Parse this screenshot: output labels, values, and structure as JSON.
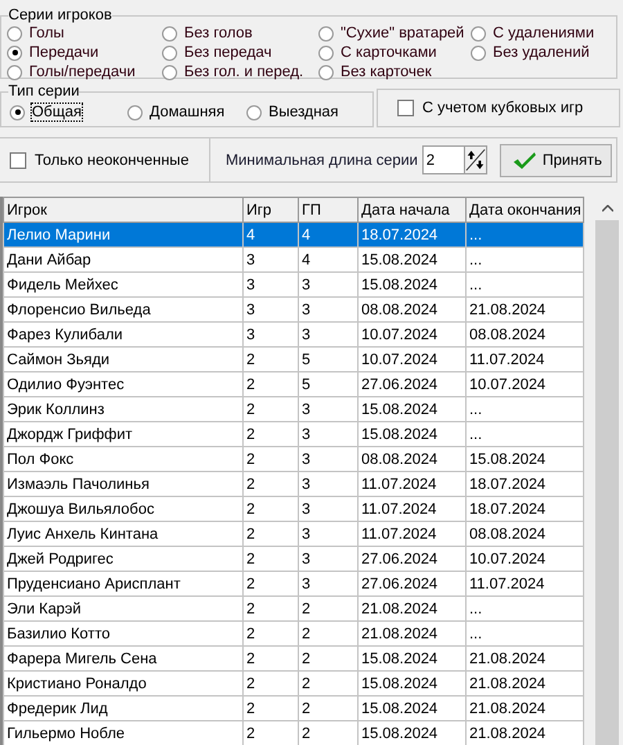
{
  "series_group": {
    "legend": "Серии игроков",
    "options": [
      {
        "label": "Голы",
        "selected": false
      },
      {
        "label": "Без голов",
        "selected": false
      },
      {
        "label": "\"Сухие\" вратарей",
        "selected": false
      },
      {
        "label": "С удалениями",
        "selected": false
      },
      {
        "label": "Передачи",
        "selected": true
      },
      {
        "label": "Без передач",
        "selected": false
      },
      {
        "label": "С карточками",
        "selected": false
      },
      {
        "label": "Без удалений",
        "selected": false
      },
      {
        "label": "Голы/передачи",
        "selected": false
      },
      {
        "label": "Без гол. и перед.",
        "selected": false
      },
      {
        "label": "Без карточек",
        "selected": false
      }
    ]
  },
  "type_group": {
    "legend": "Тип серии",
    "options": [
      {
        "label": "Общая",
        "selected": true
      },
      {
        "label": "Домашняя",
        "selected": false
      },
      {
        "label": "Выездная",
        "selected": false
      }
    ]
  },
  "cup_games": {
    "label": "С учетом кубковых игр",
    "checked": false
  },
  "only_unfinished": {
    "label": "Только неоконченные",
    "checked": false
  },
  "min_length": {
    "label": "Минимальная длина серии",
    "value": "2"
  },
  "apply_button": "Принять",
  "table": {
    "columns": [
      "Игрок",
      "Игр",
      "ГП",
      "Дата начала",
      "Дата окончания"
    ],
    "rows": [
      {
        "selected": true,
        "cells": [
          "Лелио Марини",
          "4",
          "4",
          "18.07.2024",
          "..."
        ]
      },
      {
        "selected": false,
        "cells": [
          "Дани Айбар",
          "3",
          "4",
          "15.08.2024",
          "..."
        ]
      },
      {
        "selected": false,
        "cells": [
          "Фидель Мейхес",
          "3",
          "3",
          "15.08.2024",
          "..."
        ]
      },
      {
        "selected": false,
        "cells": [
          "Флоренсио Вильеда",
          "3",
          "3",
          "08.08.2024",
          "21.08.2024"
        ]
      },
      {
        "selected": false,
        "cells": [
          "Фарез Кулибали",
          "3",
          "3",
          "10.07.2024",
          "08.08.2024"
        ]
      },
      {
        "selected": false,
        "cells": [
          "Саймон Зьяди",
          "2",
          "5",
          "10.07.2024",
          "11.07.2024"
        ]
      },
      {
        "selected": false,
        "cells": [
          "Одилио Фуэнтес",
          "2",
          "5",
          "27.06.2024",
          "10.07.2024"
        ]
      },
      {
        "selected": false,
        "cells": [
          "Эрик Коллинз",
          "2",
          "3",
          "15.08.2024",
          "..."
        ]
      },
      {
        "selected": false,
        "cells": [
          "Джордж Гриффит",
          "2",
          "3",
          "15.08.2024",
          "..."
        ]
      },
      {
        "selected": false,
        "cells": [
          "Пол Фокс",
          "2",
          "3",
          "08.08.2024",
          "15.08.2024"
        ]
      },
      {
        "selected": false,
        "cells": [
          "Измаэль Пачолинья",
          "2",
          "3",
          "11.07.2024",
          "18.07.2024"
        ]
      },
      {
        "selected": false,
        "cells": [
          "Джошуа Вильялобос",
          "2",
          "3",
          "11.07.2024",
          "18.07.2024"
        ]
      },
      {
        "selected": false,
        "cells": [
          "Луис Анхель Кинтана",
          "2",
          "3",
          "11.07.2024",
          "08.08.2024"
        ]
      },
      {
        "selected": false,
        "cells": [
          "Джей Родригес",
          "2",
          "3",
          "27.06.2024",
          "10.07.2024"
        ]
      },
      {
        "selected": false,
        "cells": [
          "Пруденсиано Арисплант",
          "2",
          "3",
          "27.06.2024",
          "11.07.2024"
        ]
      },
      {
        "selected": false,
        "cells": [
          "Эли Карэй",
          "2",
          "2",
          "21.08.2024",
          "..."
        ]
      },
      {
        "selected": false,
        "cells": [
          "Базилио Котто",
          "2",
          "2",
          "21.08.2024",
          "..."
        ]
      },
      {
        "selected": false,
        "cells": [
          "Фарера Мигель Сена",
          "2",
          "2",
          "15.08.2024",
          "21.08.2024"
        ]
      },
      {
        "selected": false,
        "cells": [
          "Кристиано Роналдо",
          "2",
          "2",
          "15.08.2024",
          "21.08.2024"
        ]
      },
      {
        "selected": false,
        "cells": [
          "Фредерик Лид",
          "2",
          "2",
          "15.08.2024",
          "21.08.2024"
        ]
      },
      {
        "selected": false,
        "cells": [
          "Гильермо Нобле",
          "2",
          "2",
          "15.08.2024",
          "21.08.2024"
        ]
      }
    ]
  }
}
